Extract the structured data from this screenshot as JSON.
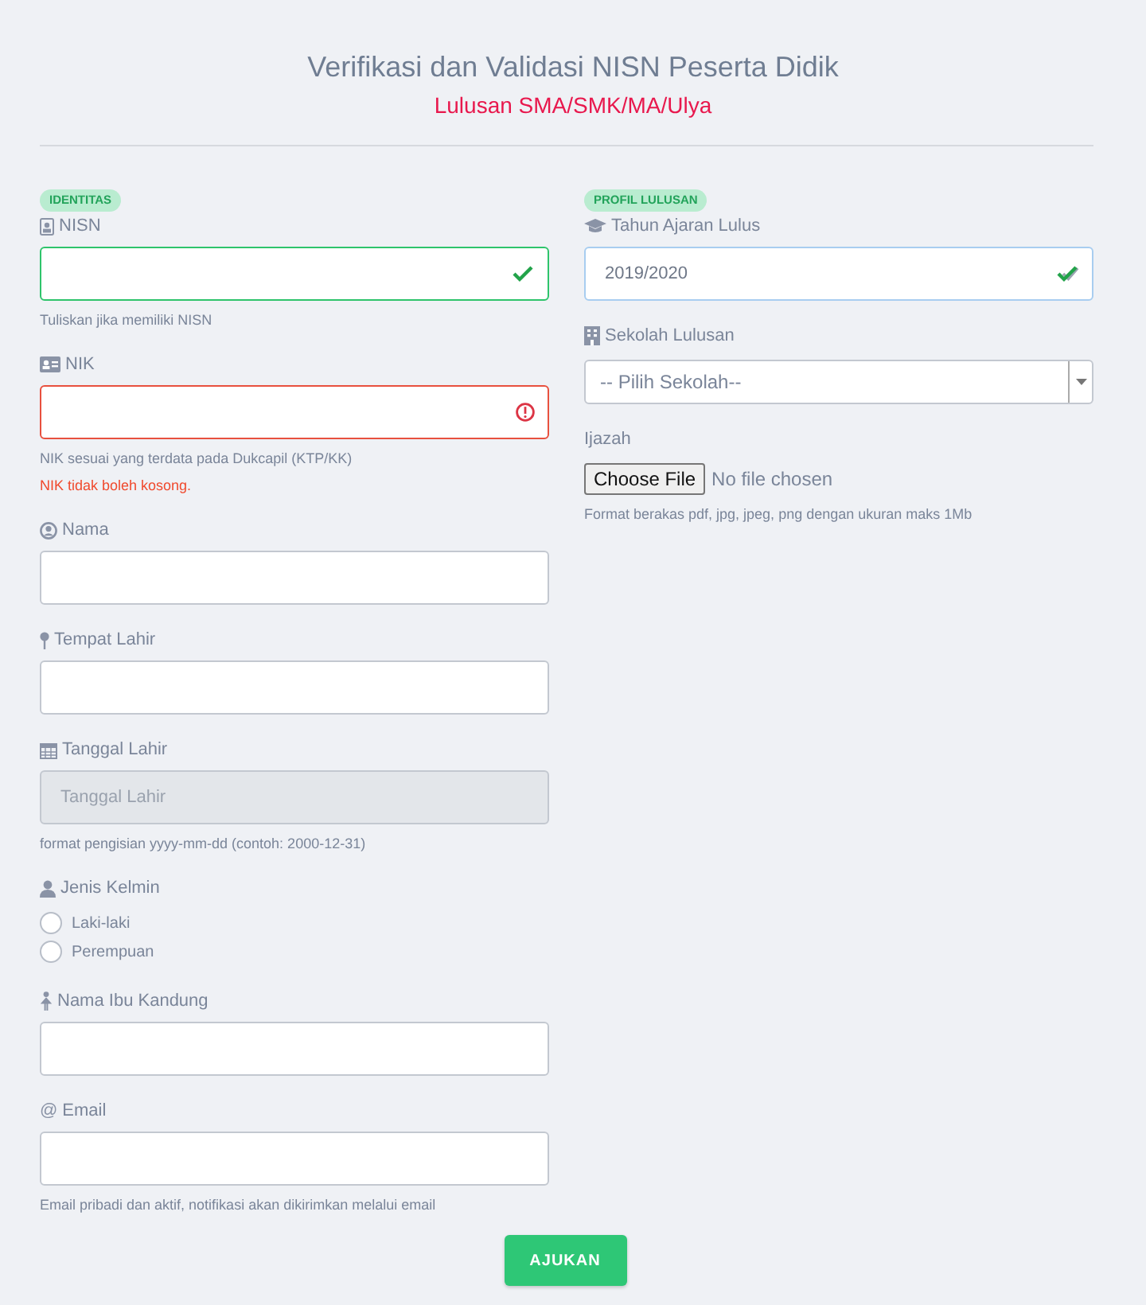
{
  "header": {
    "title": "Verifikasi dan Validasi NISN Peserta Didik",
    "subtitle": "Lulusan SMA/SMK/MA/Ulya"
  },
  "sections": [
    {
      "badge": "IDENTITAS",
      "fields": [
        {
          "kind": "text",
          "label": "NISN",
          "valid": true,
          "invalid": false,
          "help": "Tuliskan jika memiliki NISN"
        },
        {
          "kind": "text",
          "label": "NIK",
          "valid": false,
          "invalid": true,
          "help": "NIK sesuai yang terdata pada Dukcapil (KTP/KK)",
          "error": "NIK tidak boleh kosong."
        },
        {
          "kind": "text",
          "label": "Nama"
        },
        {
          "kind": "text",
          "label": "Tempat Lahir"
        },
        {
          "kind": "text",
          "label": "Tanggal Lahir",
          "disabled": true,
          "placeholder": "Tanggal Lahir",
          "help": "format pengisian yyyy-mm-dd (contoh: 2000-12-31)"
        },
        {
          "kind": "radio",
          "label": "Jenis Kelmin",
          "options": [
            {
              "label": "Laki-laki",
              "selected": false
            },
            {
              "label": "Perempuan",
              "selected": false
            }
          ]
        },
        {
          "kind": "text",
          "label": "Nama Ibu Kandung"
        },
        {
          "kind": "text",
          "label": "Email",
          "symbol": "@",
          "help": "Email pribadi dan aktif, notifikasi akan dikirimkan melalui email"
        }
      ]
    },
    {
      "badge": "PROFIL LULUSAN",
      "fields": [
        {
          "kind": "text",
          "label": "Tahun Ajaran Lulus",
          "value": "2019/2020",
          "valid": true,
          "invalid": false,
          "focused": true
        },
        {
          "kind": "select",
          "label": "Sekolah Lulusan",
          "value": "-- Pilih Sekolah--"
        },
        {
          "kind": "file",
          "label": "Ijazah",
          "button": "Choose File",
          "status": "No file chosen",
          "help": "Format berakas pdf, jpg, jpeg, png dengan ukuran maks 1Mb"
        }
      ]
    }
  ],
  "submit": "AJUKAN"
}
